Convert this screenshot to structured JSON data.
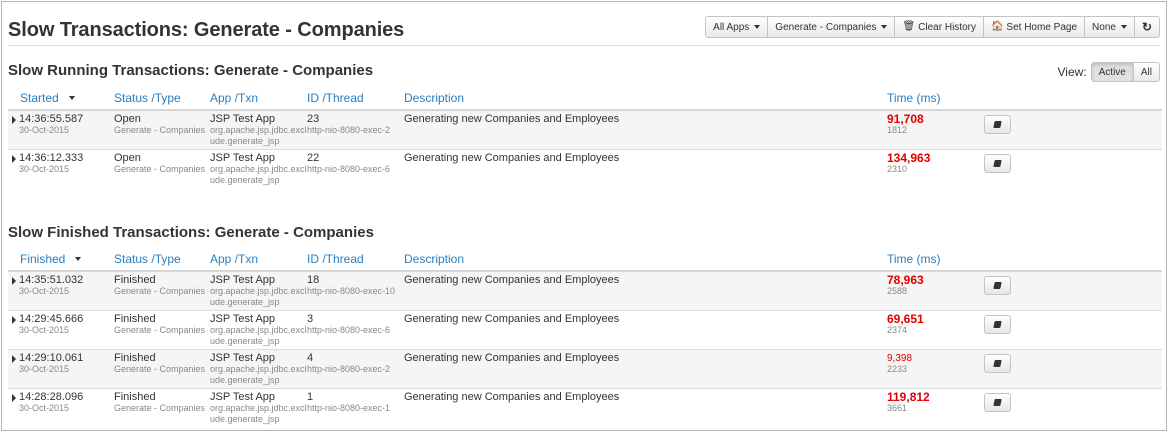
{
  "page": {
    "title": "Slow Transactions: Generate - Companies"
  },
  "toolbar": {
    "apps_label": "All Apps",
    "generate_label": "Generate - Companies",
    "clear_label": "Clear History",
    "home_label": "Set Home Page",
    "none_label": "None",
    "trash_glyph": "🗑",
    "home_glyph": "🏠",
    "refresh_glyph": "↻"
  },
  "running": {
    "title": "Slow Running Transactions: Generate - Companies",
    "view_label": "View:",
    "view_active": "Active",
    "view_all": "All",
    "headers": {
      "started": "Started",
      "status": "Status /Type",
      "app": "App /Txn",
      "id": "ID /Thread",
      "desc": "Description",
      "time": "Time (ms)"
    },
    "rows": [
      {
        "time": "14:36:55.587",
        "date": "30-Oct-2015",
        "status": "Open",
        "type": "Generate - Companies",
        "app": "JSP Test App",
        "txn": "org.apache.jsp.jdbc.exclude.generate_jsp",
        "id": "23",
        "thread": "http-nio-8080-exec-2",
        "desc": "Generating new Companies and Employees",
        "ms": "91,708",
        "ms2": "1812",
        "small": false
      },
      {
        "time": "14:36:12.333",
        "date": "30-Oct-2015",
        "status": "Open",
        "type": "Generate - Companies",
        "app": "JSP Test App",
        "txn": "org.apache.jsp.jdbc.exclude.generate_jsp",
        "id": "22",
        "thread": "http-nio-8080-exec-6",
        "desc": "Generating new Companies and Employees",
        "ms": "134,963",
        "ms2": "2310",
        "small": false
      }
    ]
  },
  "finished": {
    "title": "Slow Finished Transactions: Generate - Companies",
    "headers": {
      "started": "Finished",
      "status": "Status /Type",
      "app": "App /Txn",
      "id": "ID /Thread",
      "desc": "Description",
      "time": "Time (ms)"
    },
    "rows": [
      {
        "time": "14:35:51.032",
        "date": "30-Oct-2015",
        "status": "Finished",
        "type": "Generate - Companies",
        "app": "JSP Test App",
        "txn": "org.apache.jsp.jdbc.exclude.generate_jsp",
        "id": "18",
        "thread": "http-nio-8080-exec-10",
        "desc": "Generating new Companies and Employees",
        "ms": "78,963",
        "ms2": "2588",
        "small": false
      },
      {
        "time": "14:29:45.666",
        "date": "30-Oct-2015",
        "status": "Finished",
        "type": "Generate - Companies",
        "app": "JSP Test App",
        "txn": "org.apache.jsp.jdbc.exclude.generate_jsp",
        "id": "3",
        "thread": "http-nio-8080-exec-6",
        "desc": "Generating new Companies and Employees",
        "ms": "69,651",
        "ms2": "2374",
        "small": false
      },
      {
        "time": "14:29:10.061",
        "date": "30-Oct-2015",
        "status": "Finished",
        "type": "Generate - Companies",
        "app": "JSP Test App",
        "txn": "org.apache.jsp.jdbc.exclude.generate_jsp",
        "id": "4",
        "thread": "http-nio-8080-exec-2",
        "desc": "Generating new Companies and Employees",
        "ms": "9,398",
        "ms2": "2233",
        "small": true
      },
      {
        "time": "14:28:28.096",
        "date": "30-Oct-2015",
        "status": "Finished",
        "type": "Generate - Companies",
        "app": "JSP Test App",
        "txn": "org.apache.jsp.jdbc.exclude.generate_jsp",
        "id": "1",
        "thread": "http-nio-8080-exec-1",
        "desc": "Generating new Companies and Employees",
        "ms": "119,812",
        "ms2": "3661",
        "small": false
      }
    ]
  },
  "colors": {
    "link": "#2a7fc0",
    "slow_time": "#e00000"
  }
}
